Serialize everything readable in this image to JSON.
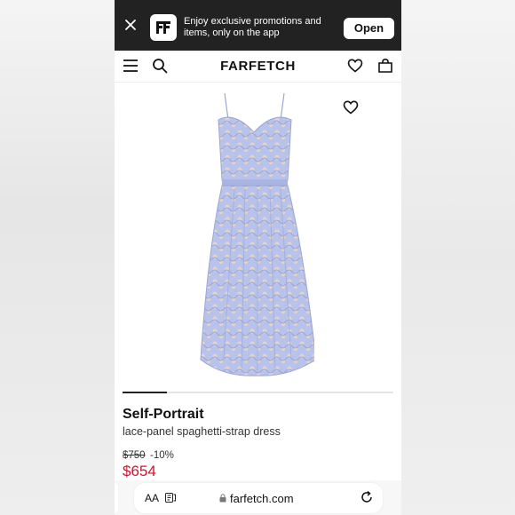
{
  "promo": {
    "text": "Enjoy exclusive promotions and items, only on the app",
    "open_label": "Open"
  },
  "header": {
    "logo": "FARFETCH"
  },
  "product": {
    "brand": "Self-Portrait",
    "description": "lace-panel spaghetti-strap dress",
    "original_price": "$750",
    "discount": "-10%",
    "price": "$654",
    "image_index": 1
  },
  "browser": {
    "aa_label": "AA",
    "url": "farfetch.com"
  },
  "colors": {
    "accent_price": "#d4112a",
    "banner_bg": "#222222",
    "dress": "#b3bfe6"
  }
}
